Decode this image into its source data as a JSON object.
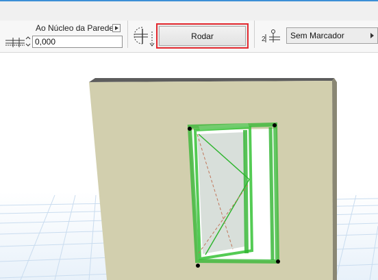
{
  "toolbar": {
    "anchor_label": "Ao Núcleo da Parede",
    "offset_value": "0,000",
    "rotate_label": "Rodar",
    "marker_value": "Sem Marcador"
  },
  "icons": {
    "anchor_menu": "triangle-right-icon",
    "offset": "offset-dimension-icon",
    "flip": "flip-side-icon",
    "marker": "marker-icon",
    "marker_caret": "triangle-right-icon"
  },
  "colors": {
    "accent_line": "#3b8fd6",
    "highlight_border": "#e3282f",
    "wall": "#d2cfae",
    "window_frame": "#2fb52f",
    "grid": "#cfe0f0"
  }
}
